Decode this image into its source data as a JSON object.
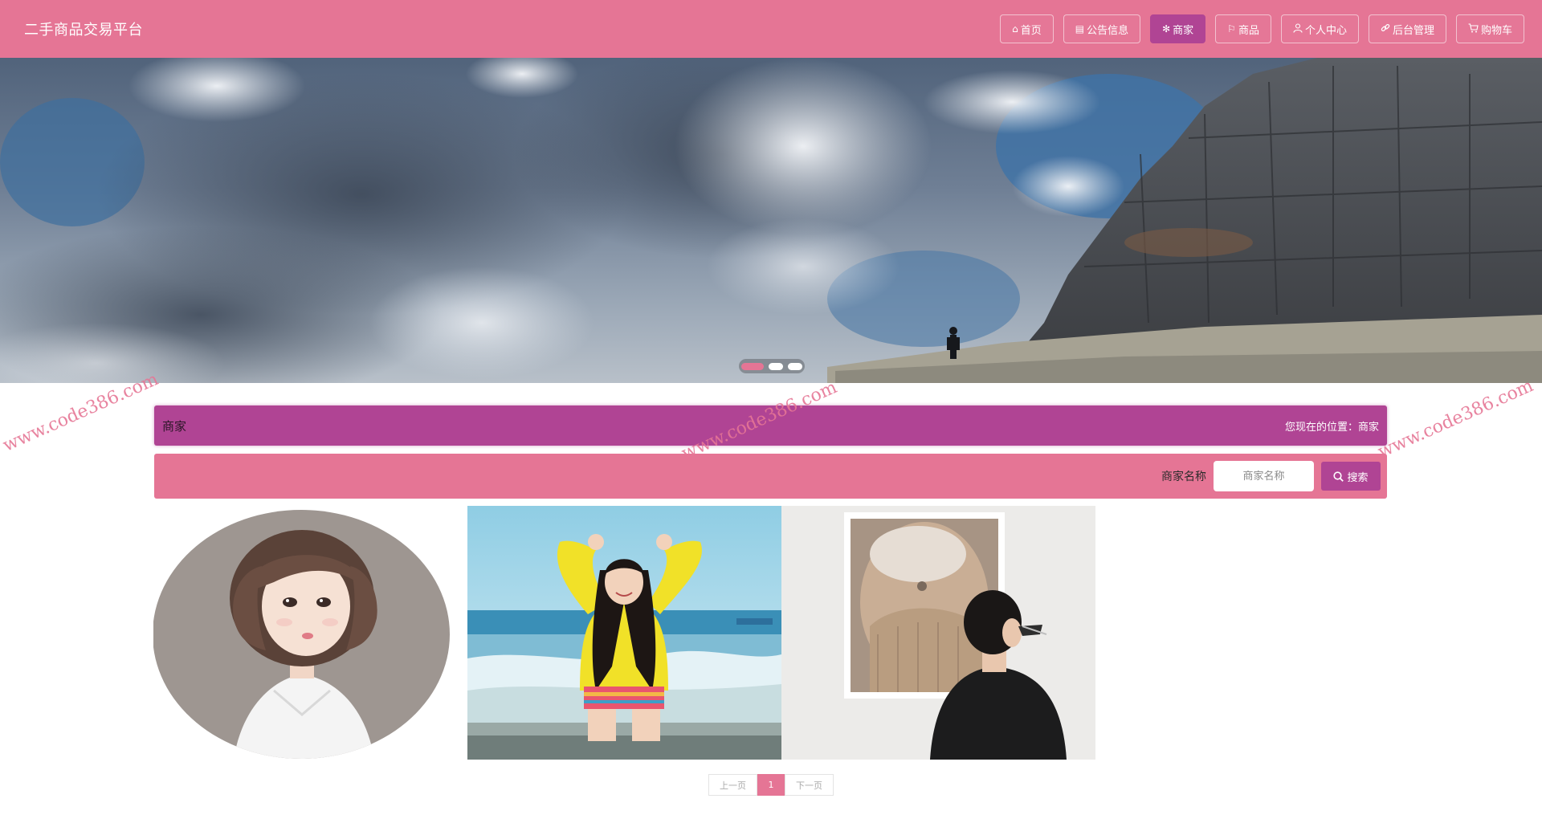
{
  "header": {
    "brand": "二手商品交易平台",
    "nav": [
      {
        "label": "首页",
        "icon": "home-icon",
        "active": false
      },
      {
        "label": "公告信息",
        "icon": "news-icon",
        "active": false
      },
      {
        "label": "商家",
        "icon": "asterisk-icon",
        "active": true
      },
      {
        "label": "商品",
        "icon": "flag-icon",
        "active": false
      },
      {
        "label": "个人中心",
        "icon": "user-icon",
        "active": false
      },
      {
        "label": "后台管理",
        "icon": "link-icon",
        "active": false
      },
      {
        "label": "购物车",
        "icon": "cart-icon",
        "active": false
      }
    ]
  },
  "banner": {
    "slide_count": 3,
    "active_slide": 1
  },
  "page": {
    "title": "商家",
    "breadcrumb": "您现在的位置：商家"
  },
  "search": {
    "label": "商家名称",
    "placeholder": "商家名称",
    "value": "",
    "button_label": "搜索"
  },
  "cards": [
    {
      "image": "cartoon-girl-portrait"
    },
    {
      "image": "girl-yellow-jacket-beach"
    },
    {
      "image": "man-looking-at-painting"
    }
  ],
  "pagination": {
    "prev_label": "上一页",
    "current_page": "1",
    "next_label": "下一页"
  },
  "watermark": "www.code386.com",
  "colors": {
    "primary": "#e57595",
    "accent": "#b04494"
  }
}
